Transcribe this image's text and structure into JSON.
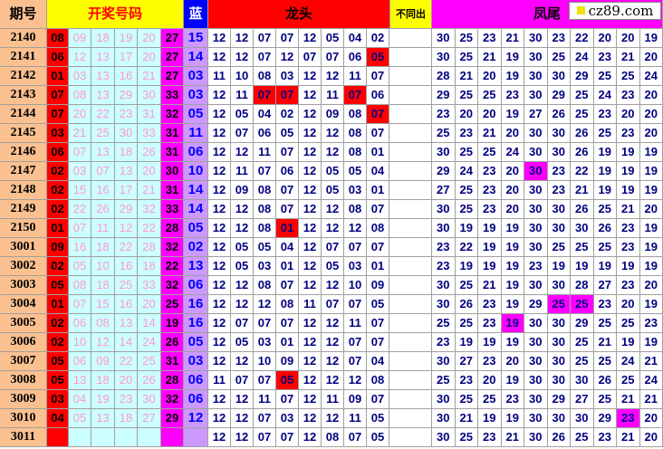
{
  "header": {
    "period": "期号",
    "draw_numbers": "开奖号码",
    "blue": "蓝",
    "dragon_head": "龙头",
    "not_repeat": "不同出",
    "phoenix_tail": "凤尾"
  },
  "watermark": "cz89.com",
  "colors": {
    "period_bg": "#fac090",
    "red": "#ff0000",
    "draw_bg": "#ccffff",
    "sum_bg": "#ff00ff",
    "blue_bg": "#cc99ff",
    "header_yellow": "#ffff00",
    "header_blue": "#0000ff",
    "number_text": "#000080"
  },
  "rows": [
    {
      "period": "2140",
      "first": "08",
      "draws": [
        "09",
        "18",
        "19",
        "20"
      ],
      "sum": "27",
      "blue": "15",
      "heads": [
        "12",
        "12",
        "07",
        "07",
        "12",
        "05",
        "04",
        "02"
      ],
      "head_hi": [],
      "tails": [
        "30",
        "25",
        "23",
        "21",
        "30",
        "23",
        "22",
        "20",
        "20",
        "19"
      ],
      "tail_hi": []
    },
    {
      "period": "2141",
      "first": "06",
      "draws": [
        "12",
        "13",
        "17",
        "20"
      ],
      "sum": "27",
      "blue": "14",
      "heads": [
        "12",
        "12",
        "07",
        "12",
        "07",
        "07",
        "06",
        "05"
      ],
      "head_hi": [
        7
      ],
      "tails": [
        "30",
        "25",
        "21",
        "19",
        "30",
        "25",
        "24",
        "23",
        "21",
        "20"
      ],
      "tail_hi": []
    },
    {
      "period": "2142",
      "first": "01",
      "draws": [
        "03",
        "13",
        "16",
        "21"
      ],
      "sum": "27",
      "blue": "03",
      "heads": [
        "11",
        "10",
        "08",
        "03",
        "12",
        "12",
        "11",
        "07"
      ],
      "head_hi": [],
      "tails": [
        "28",
        "21",
        "20",
        "19",
        "30",
        "30",
        "29",
        "25",
        "25",
        "24"
      ],
      "tail_hi": []
    },
    {
      "period": "2143",
      "first": "07",
      "draws": [
        "08",
        "13",
        "29",
        "30"
      ],
      "sum": "33",
      "blue": "03",
      "heads": [
        "12",
        "11",
        "07",
        "07",
        "12",
        "11",
        "07",
        "06"
      ],
      "head_hi": [
        2,
        3,
        6
      ],
      "tails": [
        "29",
        "25",
        "25",
        "23",
        "30",
        "29",
        "25",
        "24",
        "23",
        "20"
      ],
      "tail_hi": []
    },
    {
      "period": "2144",
      "first": "07",
      "draws": [
        "20",
        "22",
        "23",
        "31"
      ],
      "sum": "32",
      "blue": "05",
      "heads": [
        "12",
        "05",
        "04",
        "02",
        "12",
        "09",
        "08",
        "07"
      ],
      "head_hi": [
        7
      ],
      "tails": [
        "23",
        "20",
        "20",
        "19",
        "27",
        "26",
        "25",
        "23",
        "20",
        "20"
      ],
      "tail_hi": []
    },
    {
      "period": "2145",
      "first": "03",
      "draws": [
        "21",
        "25",
        "30",
        "33"
      ],
      "sum": "31",
      "blue": "11",
      "heads": [
        "12",
        "07",
        "06",
        "05",
        "12",
        "12",
        "08",
        "07"
      ],
      "head_hi": [],
      "tails": [
        "25",
        "23",
        "21",
        "20",
        "30",
        "30",
        "26",
        "25",
        "23",
        "20"
      ],
      "tail_hi": []
    },
    {
      "period": "2146",
      "first": "06",
      "draws": [
        "07",
        "13",
        "18",
        "26"
      ],
      "sum": "31",
      "blue": "06",
      "heads": [
        "12",
        "12",
        "11",
        "07",
        "12",
        "12",
        "08",
        "01"
      ],
      "head_hi": [],
      "tails": [
        "30",
        "25",
        "25",
        "24",
        "30",
        "30",
        "26",
        "19",
        "19",
        "19"
      ],
      "tail_hi": []
    },
    {
      "period": "2147",
      "first": "02",
      "draws": [
        "03",
        "07",
        "13",
        "20"
      ],
      "sum": "30",
      "blue": "10",
      "heads": [
        "12",
        "11",
        "07",
        "06",
        "12",
        "05",
        "05",
        "04"
      ],
      "head_hi": [],
      "tails": [
        "29",
        "24",
        "23",
        "20",
        "30",
        "23",
        "22",
        "19",
        "19",
        "19"
      ],
      "tail_hi": [
        4
      ]
    },
    {
      "period": "2148",
      "first": "02",
      "draws": [
        "15",
        "16",
        "17",
        "21"
      ],
      "sum": "31",
      "blue": "14",
      "heads": [
        "12",
        "09",
        "08",
        "07",
        "12",
        "05",
        "03",
        "01"
      ],
      "head_hi": [],
      "tails": [
        "27",
        "25",
        "23",
        "20",
        "30",
        "23",
        "21",
        "19",
        "19",
        "19"
      ],
      "tail_hi": []
    },
    {
      "period": "2149",
      "first": "02",
      "draws": [
        "22",
        "26",
        "29",
        "32"
      ],
      "sum": "33",
      "blue": "14",
      "heads": [
        "12",
        "12",
        "08",
        "07",
        "12",
        "12",
        "08",
        "07"
      ],
      "head_hi": [],
      "tails": [
        "30",
        "25",
        "23",
        "20",
        "30",
        "30",
        "26",
        "25",
        "21",
        "20"
      ],
      "tail_hi": []
    },
    {
      "period": "2150",
      "first": "01",
      "draws": [
        "07",
        "11",
        "12",
        "22"
      ],
      "sum": "28",
      "blue": "05",
      "heads": [
        "12",
        "12",
        "08",
        "01",
        "12",
        "12",
        "12",
        "08"
      ],
      "head_hi": [
        3
      ],
      "tails": [
        "30",
        "19",
        "19",
        "19",
        "30",
        "30",
        "30",
        "26",
        "23",
        "19"
      ],
      "tail_hi": []
    },
    {
      "period": "3001",
      "first": "09",
      "draws": [
        "16",
        "18",
        "22",
        "28"
      ],
      "sum": "32",
      "blue": "02",
      "heads": [
        "12",
        "05",
        "05",
        "04",
        "12",
        "07",
        "07",
        "07"
      ],
      "head_hi": [],
      "tails": [
        "23",
        "22",
        "19",
        "19",
        "30",
        "25",
        "25",
        "25",
        "23",
        "19"
      ],
      "tail_hi": []
    },
    {
      "period": "3002",
      "first": "02",
      "draws": [
        "05",
        "10",
        "16",
        "18"
      ],
      "sum": "22",
      "blue": "13",
      "heads": [
        "12",
        "05",
        "03",
        "01",
        "12",
        "05",
        "03",
        "01"
      ],
      "head_hi": [],
      "tails": [
        "23",
        "19",
        "19",
        "19",
        "23",
        "19",
        "19",
        "19",
        "19",
        "19"
      ],
      "tail_hi": []
    },
    {
      "period": "3003",
      "first": "05",
      "draws": [
        "08",
        "18",
        "25",
        "33"
      ],
      "sum": "32",
      "blue": "06",
      "heads": [
        "12",
        "12",
        "08",
        "07",
        "12",
        "12",
        "10",
        "09"
      ],
      "head_hi": [],
      "tails": [
        "30",
        "25",
        "21",
        "19",
        "30",
        "30",
        "28",
        "27",
        "23",
        "20"
      ],
      "tail_hi": []
    },
    {
      "period": "3004",
      "first": "01",
      "draws": [
        "07",
        "15",
        "16",
        "20"
      ],
      "sum": "25",
      "blue": "16",
      "heads": [
        "12",
        "12",
        "12",
        "08",
        "11",
        "07",
        "07",
        "05"
      ],
      "head_hi": [],
      "tails": [
        "30",
        "26",
        "23",
        "19",
        "29",
        "25",
        "25",
        "23",
        "20",
        "19"
      ],
      "tail_hi": [
        5,
        6
      ]
    },
    {
      "period": "3005",
      "first": "02",
      "draws": [
        "06",
        "08",
        "13",
        "14"
      ],
      "sum": "19",
      "blue": "16",
      "heads": [
        "12",
        "07",
        "07",
        "07",
        "12",
        "12",
        "11",
        "07"
      ],
      "head_hi": [],
      "tails": [
        "25",
        "25",
        "23",
        "19",
        "30",
        "30",
        "29",
        "25",
        "25",
        "23"
      ],
      "tail_hi": [
        3
      ]
    },
    {
      "period": "3006",
      "first": "02",
      "draws": [
        "10",
        "12",
        "14",
        "24"
      ],
      "sum": "26",
      "blue": "05",
      "heads": [
        "12",
        "05",
        "03",
        "01",
        "12",
        "12",
        "07",
        "07"
      ],
      "head_hi": [],
      "tails": [
        "23",
        "19",
        "19",
        "19",
        "30",
        "30",
        "25",
        "21",
        "19",
        "19"
      ],
      "tail_hi": []
    },
    {
      "period": "3007",
      "first": "05",
      "draws": [
        "06",
        "09",
        "22",
        "25"
      ],
      "sum": "31",
      "blue": "03",
      "heads": [
        "12",
        "12",
        "10",
        "09",
        "12",
        "12",
        "07",
        "04"
      ],
      "head_hi": [],
      "tails": [
        "30",
        "27",
        "23",
        "20",
        "30",
        "30",
        "25",
        "25",
        "24",
        "21"
      ],
      "tail_hi": []
    },
    {
      "period": "3008",
      "first": "05",
      "draws": [
        "13",
        "18",
        "20",
        "26"
      ],
      "sum": "28",
      "blue": "06",
      "heads": [
        "11",
        "07",
        "07",
        "05",
        "12",
        "12",
        "12",
        "08"
      ],
      "head_hi": [
        3
      ],
      "tails": [
        "25",
        "23",
        "20",
        "19",
        "30",
        "30",
        "30",
        "26",
        "25",
        "24"
      ],
      "tail_hi": []
    },
    {
      "period": "3009",
      "first": "03",
      "draws": [
        "04",
        "19",
        "23",
        "30"
      ],
      "sum": "32",
      "blue": "06",
      "heads": [
        "12",
        "12",
        "11",
        "07",
        "12",
        "11",
        "09",
        "07"
      ],
      "head_hi": [],
      "tails": [
        "30",
        "25",
        "25",
        "23",
        "30",
        "29",
        "27",
        "25",
        "21",
        "21"
      ],
      "tail_hi": []
    },
    {
      "period": "3010",
      "first": "04",
      "draws": [
        "05",
        "13",
        "18",
        "27"
      ],
      "sum": "29",
      "blue": "12",
      "heads": [
        "12",
        "12",
        "07",
        "03",
        "12",
        "12",
        "11",
        "05"
      ],
      "head_hi": [],
      "tails": [
        "30",
        "21",
        "19",
        "19",
        "30",
        "30",
        "30",
        "29",
        "23",
        "20"
      ],
      "tail_hi": [
        8
      ]
    },
    {
      "period": "3011",
      "first": "",
      "draws": [
        "",
        "",
        "",
        ""
      ],
      "sum": "",
      "blue": "",
      "heads": [
        "12",
        "12",
        "07",
        "07",
        "12",
        "08",
        "07",
        "05"
      ],
      "head_hi": [],
      "tails": [
        "30",
        "25",
        "23",
        "21",
        "30",
        "26",
        "25",
        "23",
        "21",
        "20"
      ],
      "tail_hi": []
    }
  ]
}
